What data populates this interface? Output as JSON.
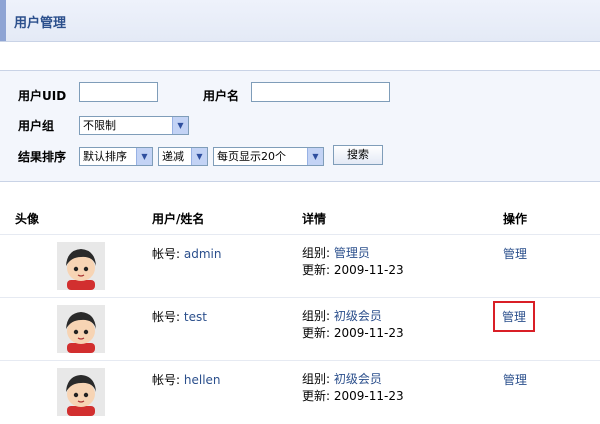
{
  "header": {
    "title": "用户管理"
  },
  "search": {
    "uid_label": "用户UID",
    "uid_value": "",
    "username_label": "用户名",
    "username_value": "",
    "group_label": "用户组",
    "group_selected": "不限制",
    "sort_label": "结果排序",
    "sort_selected": "默认排序",
    "order_selected": "递减",
    "perpage_selected": "每页显示20个",
    "search_button": "搜索"
  },
  "table": {
    "headers": [
      "头像",
      "用户/姓名",
      "详情",
      "操作"
    ],
    "rows": [
      {
        "account_label": "帐号:",
        "account": "admin",
        "group_label": "组别:",
        "group": "管理员",
        "update_label": "更新:",
        "updated": "2009-11-23",
        "action": "管理"
      },
      {
        "account_label": "帐号:",
        "account": "test",
        "group_label": "组别:",
        "group": "初级会员",
        "update_label": "更新:",
        "updated": "2009-11-23",
        "action": "管理"
      },
      {
        "account_label": "帐号:",
        "account": "hellen",
        "group_label": "组别:",
        "group": "初级会员",
        "update_label": "更新:",
        "updated": "2009-11-23",
        "action": "管理"
      }
    ]
  },
  "colors": {
    "accent": "#2b4f8c",
    "highlight": "#d91f26",
    "panel": "#f3f6fc"
  },
  "icons": {
    "avatar": "cartoon-avatar-icon",
    "dropdown": "chevron-down-icon"
  }
}
